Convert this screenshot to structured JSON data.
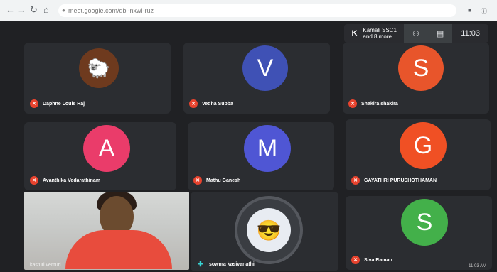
{
  "browser": {
    "url": "meet.google.com/dbi-nxwi-ruz",
    "right_icon": "■",
    "profile_icon": "ⓘ"
  },
  "topbar": {
    "presenter_initial": "K",
    "presenter_names": "Kamali SSC1",
    "presenter_more": "and 8 more",
    "time": "11:03"
  },
  "participants": [
    {
      "name": "Daphne Louis Raj",
      "type": "image"
    },
    {
      "name": "Vedha Subba",
      "initial": "V",
      "color": "#3f51b5"
    },
    {
      "name": "Shakira shakira",
      "initial": "S",
      "color": "#e8552b"
    },
    {
      "name": "Avanthika Vedarathinam",
      "initial": "A",
      "color": "#ea3c6a"
    },
    {
      "name": "Mathu Ganesh",
      "initial": "M",
      "color": "#4f56d4"
    },
    {
      "name": "GAYATHRI PURUSHOTHAMAN",
      "initial": "G",
      "color": "#f05024"
    },
    {
      "name": "kasturi vemuri",
      "type": "camera"
    },
    {
      "name": "sowma kasivanathi",
      "type": "minion"
    },
    {
      "name": "Siva Raman",
      "initial": "S",
      "color": "#43b04a"
    }
  ],
  "footer": {
    "date": "11:03 AM"
  }
}
